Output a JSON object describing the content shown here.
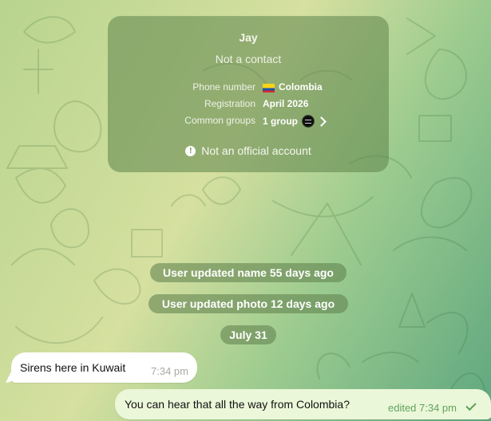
{
  "profile_card": {
    "name": "Jay",
    "subtitle": "Not a contact",
    "details": [
      {
        "label": "Phone number",
        "value": "Colombia",
        "icon": "colombia-flag"
      },
      {
        "label": "Registration",
        "value": "April 2026"
      },
      {
        "label": "Common groups",
        "value": "1 group",
        "icon": "group-avatar",
        "trailing_icon": "chevron-right-icon"
      }
    ],
    "notice": "Not an official account"
  },
  "service_messages": [
    {
      "text": "User updated name 55 days ago"
    },
    {
      "text": "User updated photo 12 days ago"
    },
    {
      "text": "July 31"
    }
  ],
  "messages": [
    {
      "direction": "incoming",
      "text": "Sirens here in Kuwait",
      "time": "7:34 pm"
    },
    {
      "direction": "outgoing",
      "text": "You can hear that all the way from Colombia?",
      "time": "edited 7:34 pm",
      "status_icon": "checkmark-icon"
    }
  ],
  "colors": {
    "card_background": "#5c834a",
    "service_background": "#60824e",
    "incoming_bubble": "#ffffff",
    "outgoing_bubble": "#ebf7d9",
    "outgoing_meta": "#61a35e"
  }
}
